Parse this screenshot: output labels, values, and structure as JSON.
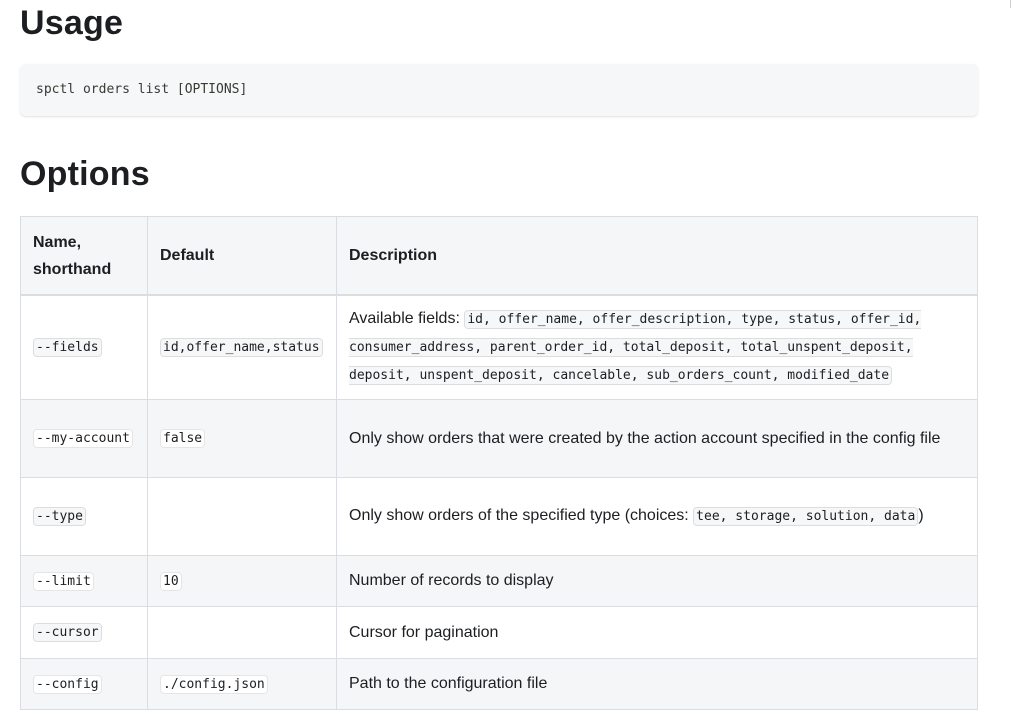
{
  "usage": {
    "title": "Usage",
    "command": "spctl orders list [OPTIONS]"
  },
  "options": {
    "title": "Options",
    "headers": {
      "name": "Name, shorthand",
      "default": "Default",
      "description": "Description"
    },
    "rows": [
      {
        "name": "--fields",
        "default": "id,offer_name,status",
        "description_prefix": "Available fields: ",
        "description_code": "id, offer_name, offer_description, type, status, offer_id, consumer_address, parent_order_id, total_deposit, total_unspent_deposit, deposit, unspent_deposit, cancelable, sub_orders_count, modified_date",
        "description_suffix": ""
      },
      {
        "name": "--my-account",
        "default": "false",
        "description_prefix": "Only show orders that were created by the action account specified in the config file",
        "description_code": "",
        "description_suffix": ""
      },
      {
        "name": "--type",
        "default": "",
        "description_prefix": "Only show orders of the specified type (choices: ",
        "description_code": "tee, storage, solution, data",
        "description_suffix": ")"
      },
      {
        "name": "--limit",
        "default": "10",
        "description_prefix": "Number of records to display",
        "description_code": "",
        "description_suffix": ""
      },
      {
        "name": "--cursor",
        "default": "",
        "description_prefix": "Cursor for pagination",
        "description_code": "",
        "description_suffix": ""
      },
      {
        "name": "--config",
        "default": "./config.json",
        "description_prefix": "Path to the configuration file",
        "description_code": "",
        "description_suffix": ""
      }
    ]
  }
}
